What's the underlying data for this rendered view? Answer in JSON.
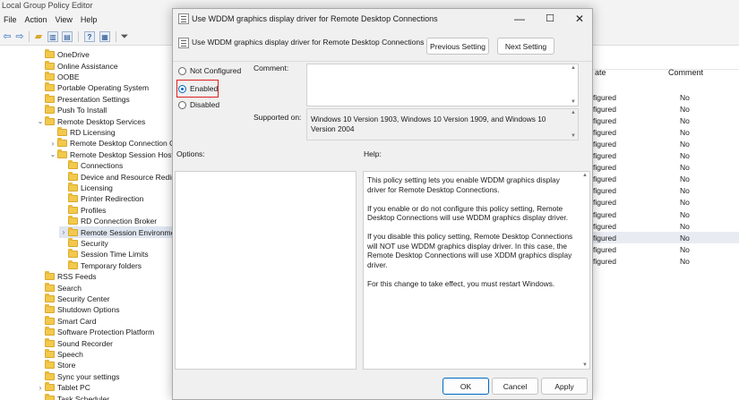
{
  "app": {
    "title": "Local Group Policy Editor",
    "menu": [
      "File",
      "Action",
      "View",
      "Help"
    ]
  },
  "tree": {
    "items": [
      {
        "label": "OneDrive",
        "level": 1,
        "chevron": ""
      },
      {
        "label": "Online Assistance",
        "level": 1,
        "chevron": ""
      },
      {
        "label": "OOBE",
        "level": 1,
        "chevron": ""
      },
      {
        "label": "Portable Operating System",
        "level": 1,
        "chevron": ""
      },
      {
        "label": "Presentation Settings",
        "level": 1,
        "chevron": ""
      },
      {
        "label": "Push To Install",
        "level": 1,
        "chevron": ""
      },
      {
        "label": "Remote Desktop Services",
        "level": 1,
        "chevron": "⌄"
      },
      {
        "label": "RD Licensing",
        "level": 2,
        "chevron": ""
      },
      {
        "label": "Remote Desktop Connection C",
        "level": 2,
        "chevron": "›"
      },
      {
        "label": "Remote Desktop Session Host",
        "level": 2,
        "chevron": "⌄"
      },
      {
        "label": "Connections",
        "level": 3,
        "chevron": ""
      },
      {
        "label": "Device and Resource Redir",
        "level": 3,
        "chevron": ""
      },
      {
        "label": "Licensing",
        "level": 3,
        "chevron": ""
      },
      {
        "label": "Printer Redirection",
        "level": 3,
        "chevron": ""
      },
      {
        "label": "Profiles",
        "level": 3,
        "chevron": ""
      },
      {
        "label": "RD Connection Broker",
        "level": 3,
        "chevron": ""
      },
      {
        "label": "Remote Session Environme",
        "level": 3,
        "chevron": "›",
        "selected": true
      },
      {
        "label": "Security",
        "level": 3,
        "chevron": ""
      },
      {
        "label": "Session Time Limits",
        "level": 3,
        "chevron": ""
      },
      {
        "label": "Temporary folders",
        "level": 3,
        "chevron": ""
      },
      {
        "label": "RSS Feeds",
        "level": 1,
        "chevron": ""
      },
      {
        "label": "Search",
        "level": 1,
        "chevron": ""
      },
      {
        "label": "Security Center",
        "level": 1,
        "chevron": ""
      },
      {
        "label": "Shutdown Options",
        "level": 1,
        "chevron": ""
      },
      {
        "label": "Smart Card",
        "level": 1,
        "chevron": ""
      },
      {
        "label": "Software Protection Platform",
        "level": 1,
        "chevron": ""
      },
      {
        "label": "Sound Recorder",
        "level": 1,
        "chevron": ""
      },
      {
        "label": "Speech",
        "level": 1,
        "chevron": ""
      },
      {
        "label": "Store",
        "level": 1,
        "chevron": ""
      },
      {
        "label": "Sync your settings",
        "level": 1,
        "chevron": ""
      },
      {
        "label": "Tablet PC",
        "level": 1,
        "chevron": "›"
      },
      {
        "label": "Task Scheduler",
        "level": 1,
        "chevron": ""
      }
    ]
  },
  "list": {
    "columns": [
      "ate",
      "Comment"
    ],
    "rows": [
      {
        "state": "figured",
        "comment": "No"
      },
      {
        "state": "figured",
        "comment": "No"
      },
      {
        "state": "figured",
        "comment": "No"
      },
      {
        "state": "figured",
        "comment": "No"
      },
      {
        "state": "figured",
        "comment": "No"
      },
      {
        "state": "figured",
        "comment": "No"
      },
      {
        "state": "figured",
        "comment": "No"
      },
      {
        "state": "figured",
        "comment": "No"
      },
      {
        "state": "figured",
        "comment": "No"
      },
      {
        "state": "figured",
        "comment": "No"
      },
      {
        "state": "figured",
        "comment": "No"
      },
      {
        "state": "figured",
        "comment": "No"
      },
      {
        "state": "figured",
        "comment": "No",
        "selected": true
      },
      {
        "state": "figured",
        "comment": "No"
      },
      {
        "state": "figured",
        "comment": "No"
      }
    ]
  },
  "dialog": {
    "title": "Use WDDM graphics display driver for Remote Desktop Connections",
    "header_title": "Use WDDM graphics display driver for Remote Desktop Connections",
    "previous_setting": "Previous Setting",
    "next_setting": "Next Setting",
    "options": {
      "not_configured": "Not Configured",
      "enabled": "Enabled",
      "disabled": "Disabled",
      "selected": "Enabled"
    },
    "comment_label": "Comment:",
    "comment_value": "",
    "supported_on_label": "Supported on:",
    "supported_on_value": "Windows 10 Version 1903, Windows 10 Version 1909, and Windows 10 Version 2004",
    "options_label": "Options:",
    "help_label": "Help:",
    "help_paragraphs": [
      "This policy setting lets you enable WDDM graphics display driver for Remote Desktop Connections.",
      "If you enable or do not configure this policy setting, Remote Desktop Connections will use WDDM graphics display driver.",
      "If you disable this policy setting, Remote Desktop Connections will NOT use WDDM graphics display driver. In this case, the Remote Desktop Connections will use XDDM graphics display driver.",
      "For this change to take effect, you must restart Windows."
    ],
    "ok": "OK",
    "cancel": "Cancel",
    "apply": "Apply"
  },
  "colors": {
    "accent": "#0067c0",
    "highlight_box": "#e02020",
    "folder": "#f2c94c"
  }
}
